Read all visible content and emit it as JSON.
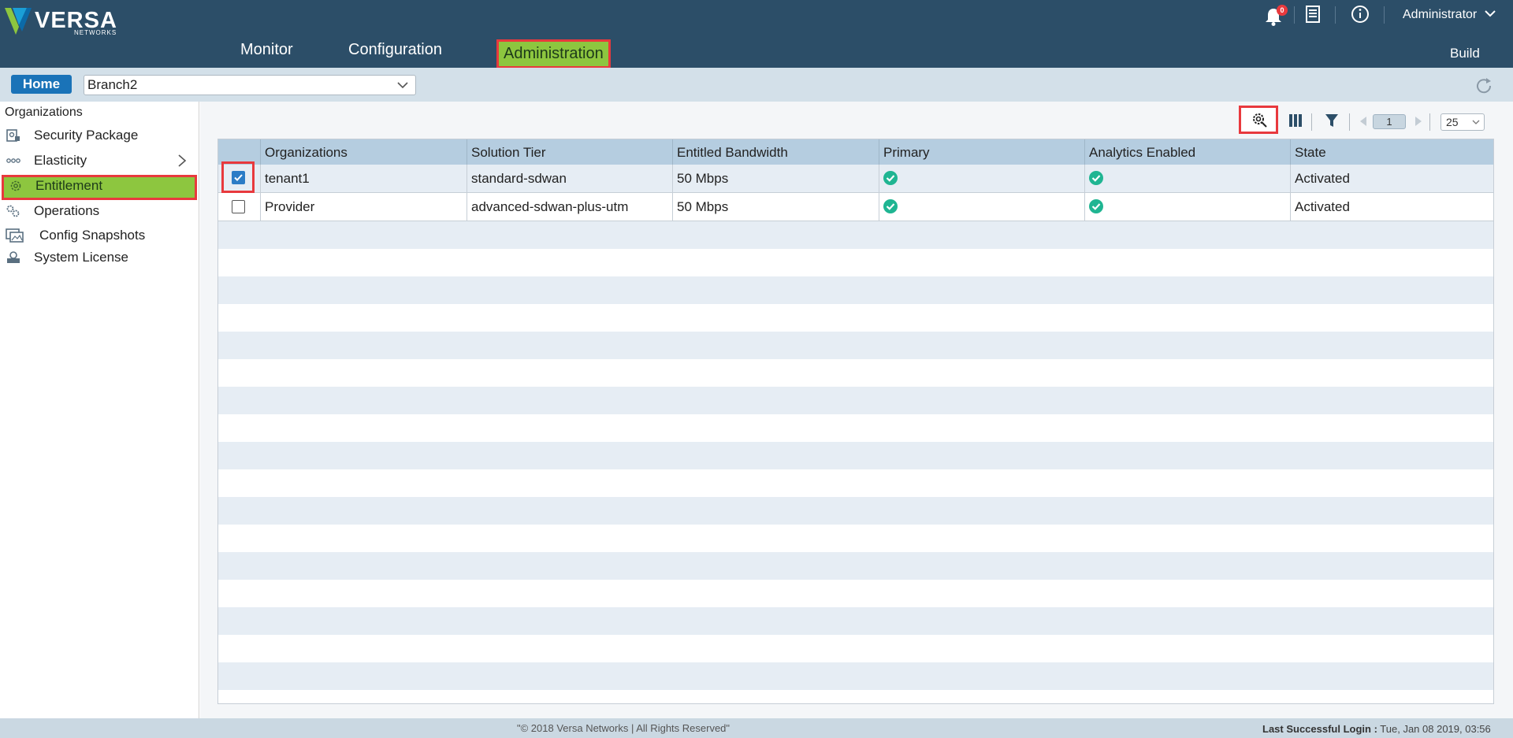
{
  "brand": {
    "name": "VERSA",
    "sub": "NETWORKS",
    "color_green": "#8dc63f",
    "color_blue": "#1a73b8"
  },
  "topnav": {
    "items": [
      {
        "label": "Monitor"
      },
      {
        "label": "Configuration"
      },
      {
        "label": "Administration",
        "active": true
      }
    ],
    "notifications_count": "0",
    "user": "Administrator",
    "build": "Build"
  },
  "crumb": {
    "home": "Home",
    "organization": "Branch2"
  },
  "sidebar": {
    "title": "Organizations",
    "items": [
      {
        "label": "Security Package",
        "icon": "security-package-icon"
      },
      {
        "label": "Elasticity",
        "icon": "elasticity-icon"
      },
      {
        "label": "Entitlement",
        "icon": "entitlement-gear-icon",
        "active": true
      },
      {
        "label": "Operations",
        "icon": "operations-gears-icon"
      },
      {
        "label": "Config Snapshots",
        "icon": "config-snapshots-icon"
      },
      {
        "label": "System License",
        "icon": "system-license-icon"
      }
    ]
  },
  "toolbar": {
    "page": "1",
    "page_size": "25"
  },
  "table": {
    "headers": [
      "Organizations",
      "Solution Tier",
      "Entitled Bandwidth",
      "Primary",
      "Analytics Enabled",
      "State"
    ],
    "rows": [
      {
        "checked": true,
        "organization": "tenant1",
        "solution_tier": "standard-sdwan",
        "bandwidth": "50 Mbps",
        "primary": true,
        "analytics": true,
        "state": "Activated"
      },
      {
        "checked": false,
        "organization": "Provider",
        "solution_tier": "advanced-sdwan-plus-utm",
        "bandwidth": "50 Mbps",
        "primary": true,
        "analytics": true,
        "state": "Activated"
      }
    ]
  },
  "footer": {
    "copyright": "\"© 2018 Versa Networks | All Rights Reserved\"",
    "login_label": "Last Successful Login :",
    "login_value": " Tue, Jan 08 2019, 03:56"
  }
}
